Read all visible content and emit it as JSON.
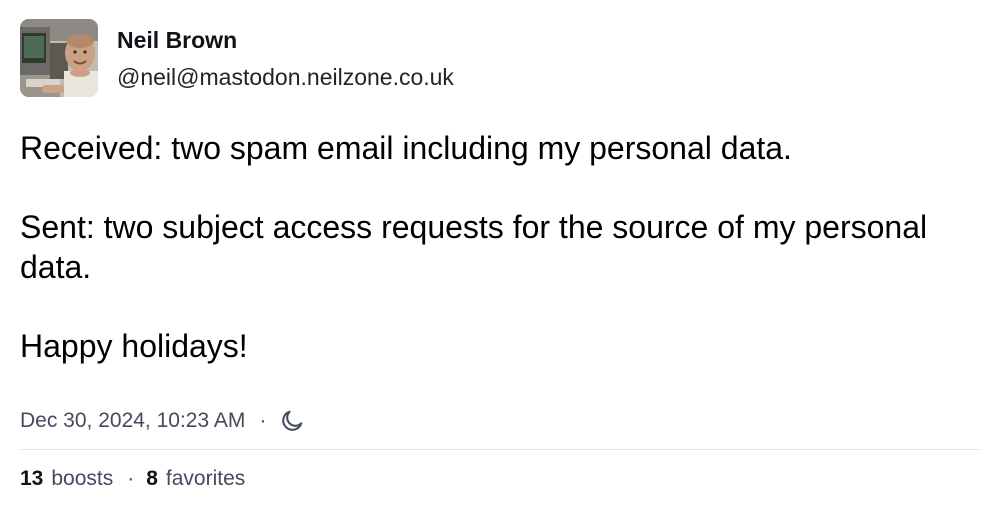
{
  "author": {
    "display_name": "Neil Brown",
    "handle": "@neil@mastodon.neilzone.co.uk",
    "avatar_icon": "user-avatar"
  },
  "post": {
    "paragraphs": [
      "Received: two spam email including my personal data.",
      "Sent: two subject access requests for the source of my personal data.",
      "Happy holidays!"
    ]
  },
  "meta": {
    "timestamp": "Dec 30, 2024, 10:23 AM",
    "separator": "·",
    "visibility_icon": "moon-icon"
  },
  "stats": {
    "boosts_count": "13",
    "boosts_label": "boosts",
    "separator": "·",
    "favorites_count": "8",
    "favorites_label": "favorites"
  },
  "colors": {
    "text": "#000000",
    "muted": "#444b5d",
    "divider": "#e3e5ea"
  }
}
